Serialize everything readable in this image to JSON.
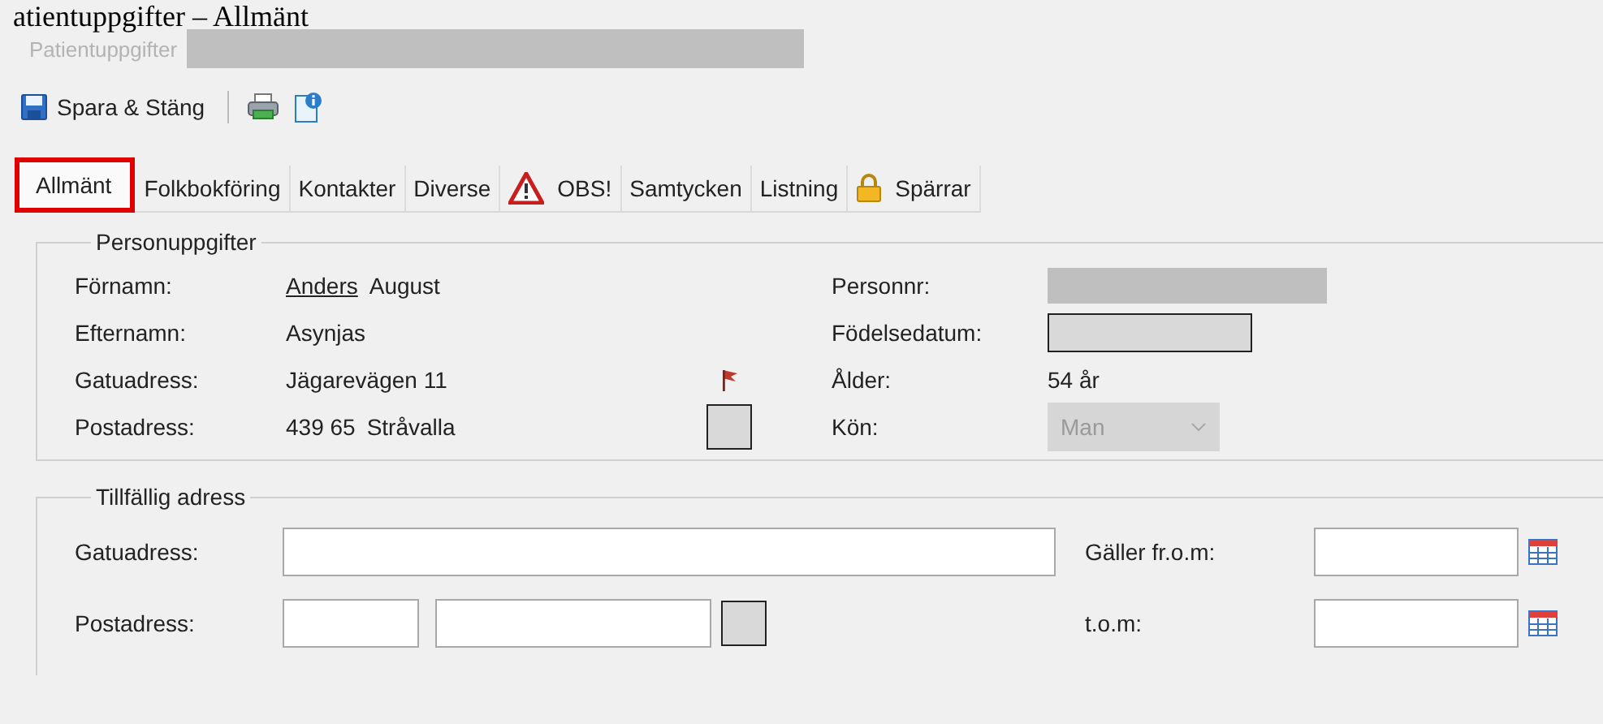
{
  "caption": "atientuppgifter – Allmänt",
  "window": {
    "title": "Patientuppgifter",
    "title_redacted": true
  },
  "toolbar": {
    "save_button": "Spara & Stäng"
  },
  "tabs": [
    {
      "label": "Allmänt",
      "selected": true,
      "highlighted": true,
      "kind": "plain"
    },
    {
      "label": "Folkbokföring",
      "selected": false,
      "highlighted": false,
      "kind": "plain"
    },
    {
      "label": "Kontakter",
      "selected": false,
      "highlighted": false,
      "kind": "plain"
    },
    {
      "label": "Diverse",
      "selected": false,
      "highlighted": false,
      "kind": "plain"
    },
    {
      "label": "OBS!",
      "selected": false,
      "highlighted": false,
      "kind": "warning"
    },
    {
      "label": "Samtycken",
      "selected": false,
      "highlighted": false,
      "kind": "plain"
    },
    {
      "label": "Listning",
      "selected": false,
      "highlighted": false,
      "kind": "plain"
    },
    {
      "label": "Spärrar",
      "selected": false,
      "highlighted": false,
      "kind": "locked"
    }
  ],
  "personal": {
    "title": "Personuppgifter",
    "left": [
      {
        "label": "Förnamn:",
        "parts": [
          {
            "text": "Anders",
            "underlined": true
          },
          {
            "text": "August",
            "underlined": false
          }
        ],
        "kind": "plain"
      },
      {
        "label": "Efternamn:",
        "parts": [
          {
            "text": "Asynjas",
            "underlined": false
          }
        ],
        "kind": "plain"
      },
      {
        "label": "Gatuadress:",
        "parts": [
          {
            "text": "Jägarevägen 11",
            "underlined": false
          }
        ],
        "kind": "flagged"
      },
      {
        "label": "Postadress:",
        "parts": [
          {
            "text": "439 65",
            "underlined": false
          },
          {
            "text": "Stråvalla",
            "underlined": false
          }
        ],
        "kind": "with_button"
      }
    ],
    "right": [
      {
        "label": "Personnr:",
        "kind": "redacted"
      },
      {
        "label": "Födelsedatum:",
        "kind": "field"
      },
      {
        "label": "Ålder:",
        "kind": "text",
        "value": "54 år"
      },
      {
        "label": "Kön:",
        "kind": "dropdown",
        "value": "Man",
        "disabled": true
      }
    ]
  },
  "temporary": {
    "title": "Tillfällig adress",
    "rows": [
      {
        "label": "Gatuadress:",
        "kind": "street",
        "date_label": "Gäller fr.o.m:"
      },
      {
        "label": "Postadress:",
        "kind": "postal",
        "date_label": "t.o.m:"
      }
    ]
  }
}
